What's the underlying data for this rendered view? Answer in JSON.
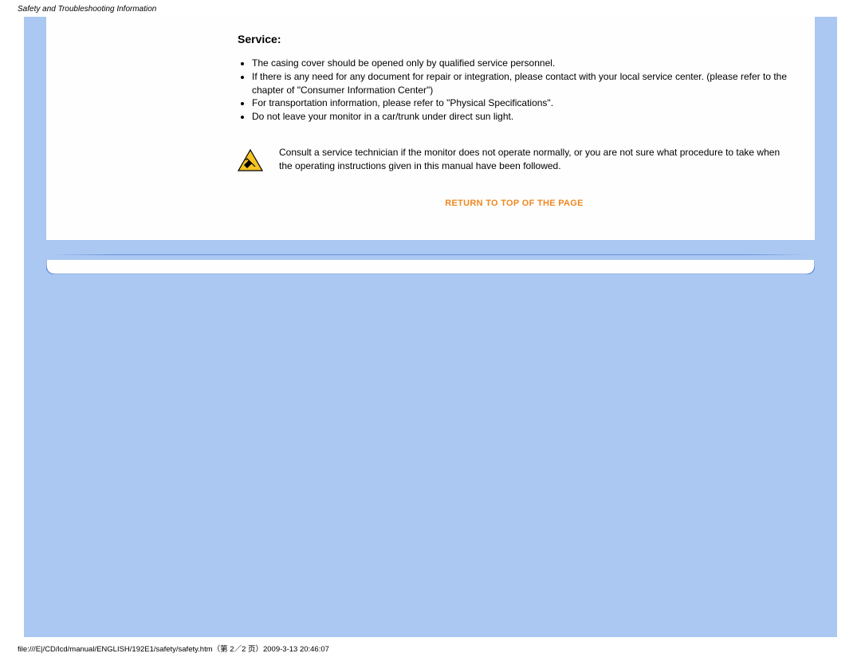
{
  "header": {
    "title": "Safety and Troubleshooting Information"
  },
  "content": {
    "heading": "Service:",
    "bullets": [
      "The casing cover should be opened only by qualified service personnel.",
      "If there is any need for any document for repair or integration, please contact with your local service center. (please refer to the chapter of \"Consumer Information Center\")",
      "For transportation information, please refer to \"Physical Specifications\".",
      "Do not leave your monitor in a car/trunk under direct sun light."
    ],
    "warning": "Consult a service technician if the monitor does not operate normally, or you are not sure what procedure to take when the operating instructions given in this manual have been followed.",
    "return_link": "RETURN TO TOP OF THE PAGE"
  },
  "footer": {
    "text": "file:///E|/CD/lcd/manual/ENGLISH/192E1/safety/safety.htm（第 2／2 页）2009-3-13 20:46:07"
  }
}
